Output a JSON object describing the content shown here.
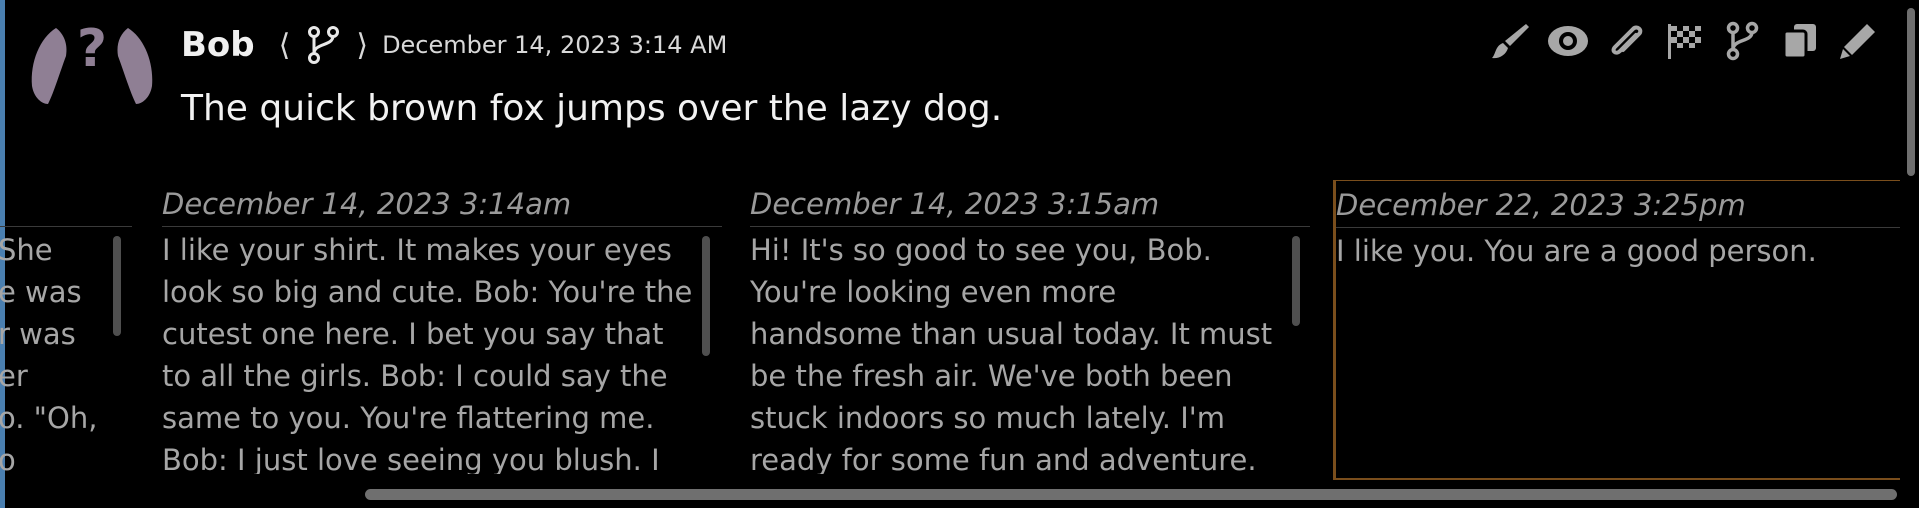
{
  "message": {
    "author": "Bob",
    "nav_prev": "⟨",
    "nav_next": "⟩",
    "timestamp": "December 14, 2023 3:14 AM",
    "text": "The quick brown fox jumps over the lazy dog."
  },
  "actions": [
    {
      "icon": "brush-icon"
    },
    {
      "icon": "eye-icon"
    },
    {
      "icon": "paperclip-icon"
    },
    {
      "icon": "checkered-flag-icon"
    },
    {
      "icon": "branch-icon"
    },
    {
      "icon": "copy-icon"
    },
    {
      "icon": "pencil-icon"
    }
  ],
  "swipes": [
    {
      "date": "",
      "lines": [
        "She",
        "e was",
        "r was",
        "er",
        "o. \"Oh,",
        "o"
      ]
    },
    {
      "date": "December 14, 2023 3:14am",
      "lines": [
        "I like your shirt. It makes your eyes",
        "look so big and cute. Bob: You're the",
        "cutest one here. I bet you say that",
        "to all the girls. Bob: I could say the",
        "same to you. You're flattering me.",
        "Bob: I just love seeing you blush. I"
      ]
    },
    {
      "date": "December 14, 2023 3:15am",
      "lines": [
        "Hi! It's so good to see you, Bob.",
        "You're looking even more",
        "handsome than usual today. It must",
        "be the fresh air. We've both been",
        "stuck indoors so much lately. I'm",
        "ready for some fun and adventure."
      ]
    },
    {
      "date": "December 22, 2023 3:25pm",
      "lines": [
        "I like you. You are a good person."
      ]
    }
  ],
  "colors": {
    "background": "#000000",
    "selected_border": "#7a4e1c",
    "icon": "#a7a7a7",
    "avatar": "#8f7f94"
  }
}
